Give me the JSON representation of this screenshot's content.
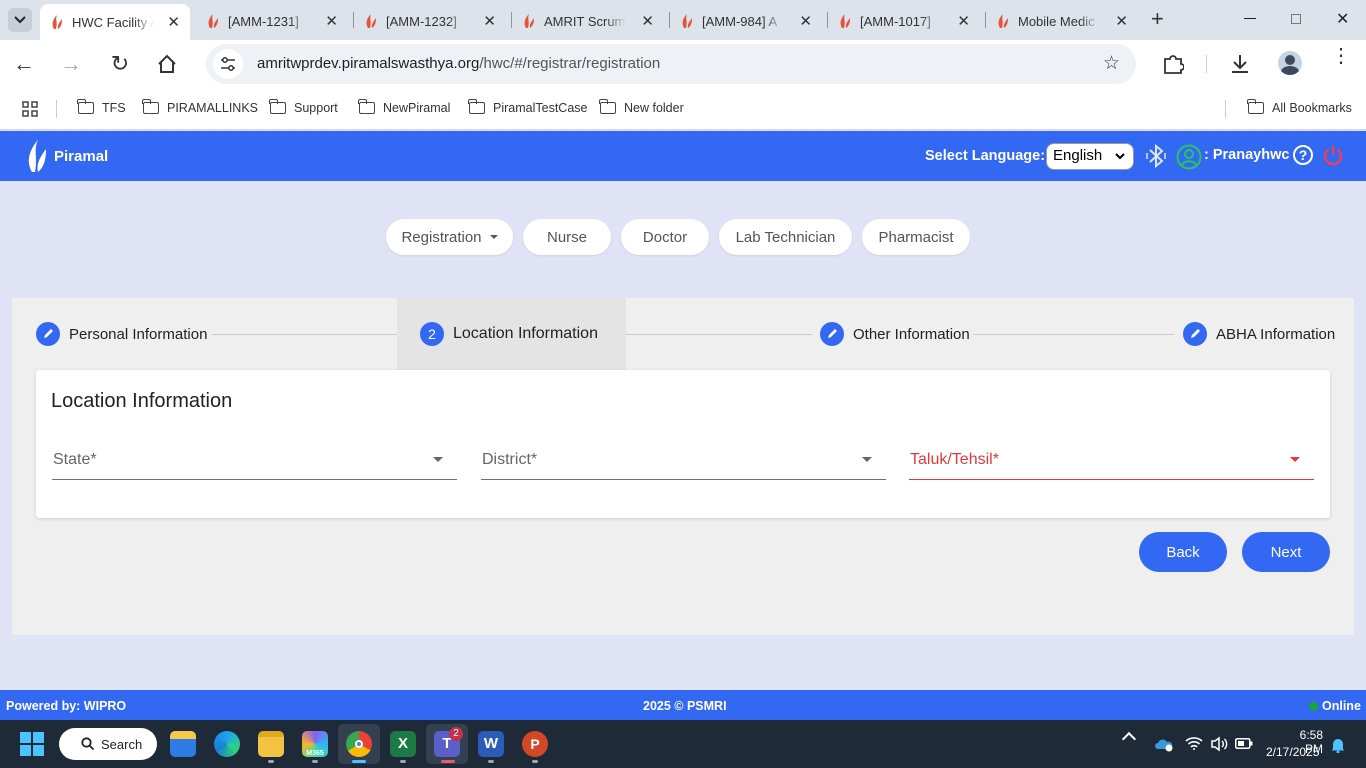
{
  "browser": {
    "tabs": [
      {
        "title": "HWC Facility A",
        "active": true
      },
      {
        "title": "[AMM-1231]"
      },
      {
        "title": "[AMM-1232]"
      },
      {
        "title": "AMRIT Scrum"
      },
      {
        "title": "[AMM-984] A"
      },
      {
        "title": "[AMM-1017]"
      },
      {
        "title": "Mobile Medic"
      }
    ],
    "url_host": "amritwprdev.piramalswasthya.org",
    "url_path": "/hwc/#/registrar/registration",
    "bookmarks": [
      "TFS",
      "PIRAMALLINKS",
      "Support",
      "NewPiramal",
      "PiramalTestCase",
      "New folder"
    ],
    "all_bookmarks": "All Bookmarks"
  },
  "header": {
    "brand": "Piramal",
    "lang_label": "Select Language:",
    "language": "English",
    "user": ": Pranayhwc"
  },
  "roles": [
    "Registration",
    "Nurse",
    "Doctor",
    "Lab Technician",
    "Pharmacist"
  ],
  "steps": [
    {
      "label": "Personal Information",
      "marker": "edit"
    },
    {
      "label": "Location Information",
      "marker": "2",
      "active": true
    },
    {
      "label": "Other Information",
      "marker": "edit"
    },
    {
      "label": "ABHA Information",
      "marker": "edit"
    }
  ],
  "form": {
    "title": "Location Information",
    "state": "State*",
    "district": "District*",
    "taluk": "Taluk/Tehsil*"
  },
  "buttons": {
    "back": "Back",
    "next": "Next"
  },
  "footer": {
    "powered": "Powered by: WIPRO",
    "copyright": "2025 © PSMRI",
    "status": "Online"
  },
  "taskbar": {
    "search": "Search",
    "time": "6:58 PM",
    "date": "2/17/2025",
    "teams_badge": "2",
    "m365": "M365"
  },
  "colors": {
    "primary": "#3368f2",
    "error": "#e03a3a",
    "online": "#1aa33a"
  }
}
